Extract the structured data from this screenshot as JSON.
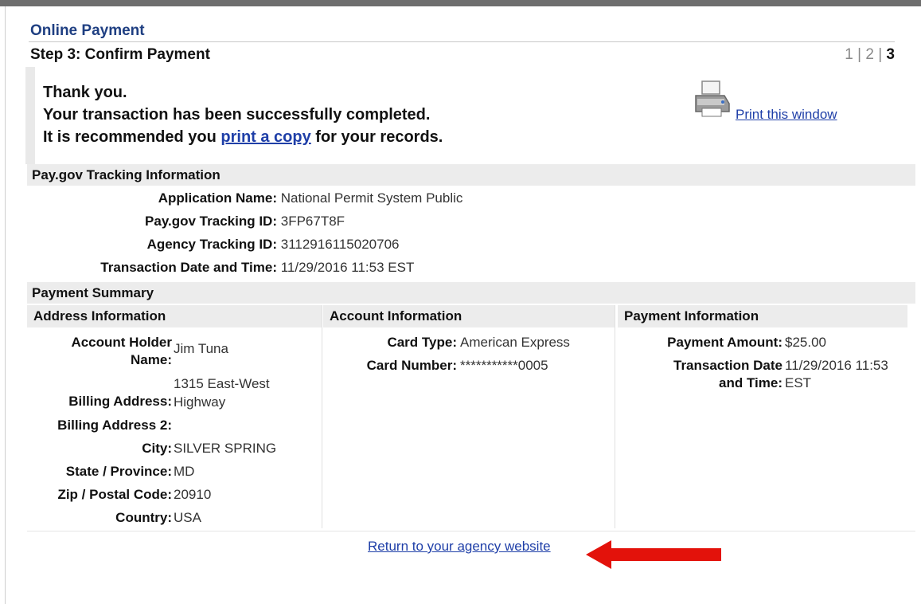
{
  "header": {
    "title": "Online Payment",
    "step_title": "Step 3: Confirm Payment",
    "steps": [
      "1",
      "2",
      "3"
    ]
  },
  "confirmation": {
    "line1": "Thank you.",
    "line2": "Your transaction has been successfully completed.",
    "line3_prefix": "It is recommended you ",
    "line3_link": "print a copy",
    "line3_suffix": " for your records."
  },
  "print": {
    "label": "Print this window",
    "icon": "printer-icon"
  },
  "tracking": {
    "heading": "Pay.gov Tracking Information",
    "rows": [
      {
        "label": "Application Name:",
        "value": "National Permit System Public"
      },
      {
        "label": "Pay.gov Tracking ID:",
        "value": "3FP67T8F"
      },
      {
        "label": "Agency Tracking ID:",
        "value": "3112916115020706"
      },
      {
        "label": "Transaction Date and Time:",
        "value": "11/29/2016 11:53 EST"
      }
    ]
  },
  "summary": {
    "heading": "Payment Summary",
    "address": {
      "heading": "Address Information",
      "account_holder_label_1": "Account Holder",
      "account_holder_label_2": "Name:",
      "account_holder_value": "Jim Tuna",
      "billing_label": "Billing Address:",
      "billing_value_1": "1315 East-West",
      "billing_value_2": "Highway",
      "billing2_label": "Billing Address 2:",
      "billing2_value": "",
      "city_label": "City:",
      "city_value": "SILVER SPRING",
      "state_label": "State / Province:",
      "state_value": "MD",
      "zip_label": "Zip / Postal Code:",
      "zip_value": "20910",
      "country_label": "Country:",
      "country_value": "USA"
    },
    "account": {
      "heading": "Account Information",
      "card_type_label": "Card Type:",
      "card_type_value": "American Express",
      "card_number_label": "Card Number:",
      "card_number_value": "***********0005"
    },
    "payment": {
      "heading": "Payment Information",
      "amount_label": "Payment Amount:",
      "amount_value": "$25.00",
      "date_label_1": "Transaction Date",
      "date_label_2": "and Time:",
      "date_value_1": "11/29/2016 11:53",
      "date_value_2": "EST"
    }
  },
  "footer": {
    "return_label": "Return to your agency website"
  },
  "colors": {
    "link": "#1f3fa8",
    "title": "#1f3f82",
    "arrow": "#e3120b",
    "bar": "#ececec"
  }
}
